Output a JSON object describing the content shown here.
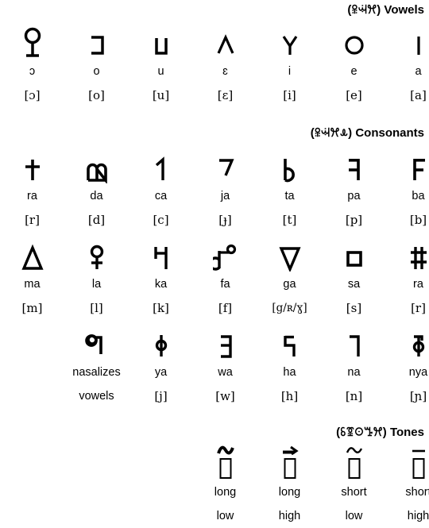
{
  "sections": {
    "vowels": {
      "native": "ꕉꕜꕮ",
      "label": "Vowels",
      "open_paren": "(",
      "close_paren": ")"
    },
    "consonants": {
      "native": "ꕉꕜꕮꕊ",
      "label": "Consonants",
      "open_paren": "(",
      "close_paren": ")"
    },
    "tones": {
      "native": "ꗏꗒꖴꔤꕮ",
      "label": "Tones",
      "open_paren": "(",
      "close_paren": ")"
    }
  },
  "vowels": [
    {
      "glyph": "ɷ",
      "icon": "vowel-glyph-o-open",
      "rom": "ɔ",
      "ipa": "[ɔ]"
    },
    {
      "glyph": "ꓱ",
      "icon": "vowel-glyph-o",
      "rom": "o",
      "ipa": "[o]"
    },
    {
      "glyph": "ᴜ",
      "icon": "vowel-glyph-u",
      "rom": "u",
      "ipa": "[u]"
    },
    {
      "glyph": "ʌ",
      "icon": "vowel-glyph-e-open",
      "rom": "ɛ",
      "ipa": "[ɛ]"
    },
    {
      "glyph": "Y",
      "icon": "vowel-glyph-i",
      "rom": "i",
      "ipa": "[i]"
    },
    {
      "glyph": "O",
      "icon": "vowel-glyph-e",
      "rom": "e",
      "ipa": "[e]"
    },
    {
      "glyph": "I",
      "icon": "vowel-glyph-a",
      "rom": "a",
      "ipa": "[a]"
    }
  ],
  "consonant_rows": [
    {
      "offset": 0,
      "items": [
        {
          "glyph": "†",
          "icon": "consonant-glyph-ra-1",
          "rom": "ra",
          "ipa": "[r]"
        },
        {
          "glyph": "ɷ",
          "icon": "consonant-glyph-da",
          "rom": "da",
          "ipa": "[d]"
        },
        {
          "glyph": "ꓸ",
          "icon": "consonant-glyph-ca",
          "rom": "ca",
          "ipa": "[c]"
        },
        {
          "glyph": "ˠ",
          "icon": "consonant-glyph-ja",
          "rom": "ja",
          "ipa": "[ɟ]"
        },
        {
          "glyph": "b",
          "icon": "consonant-glyph-ta",
          "rom": "ta",
          "ipa": "[t]"
        },
        {
          "glyph": "ꓞ",
          "icon": "consonant-glyph-pa",
          "rom": "pa",
          "ipa": "[p]"
        },
        {
          "glyph": "F",
          "icon": "consonant-glyph-ba",
          "rom": "ba",
          "ipa": "[b]"
        }
      ]
    },
    {
      "offset": 0,
      "items": [
        {
          "glyph": "Δ",
          "icon": "consonant-glyph-ma",
          "rom": "ma",
          "ipa": "[m]"
        },
        {
          "glyph": "ꝗ",
          "icon": "consonant-glyph-la",
          "rom": "la",
          "ipa": "[l]"
        },
        {
          "glyph": "ꖾ",
          "icon": "consonant-glyph-ka",
          "rom": "ka",
          "ipa": "[k]"
        },
        {
          "glyph": "ꝍ",
          "icon": "consonant-glyph-fa",
          "rom": "fa",
          "ipa": "[f]"
        },
        {
          "glyph": "∇",
          "icon": "consonant-glyph-ga",
          "rom": "ga",
          "ipa": "[g/ʀ/ɣ]"
        },
        {
          "glyph": "□",
          "icon": "consonant-glyph-sa",
          "rom": "sa",
          "ipa": "[s]"
        },
        {
          "glyph": "ǂ",
          "icon": "consonant-glyph-ra-2",
          "rom": "ra",
          "ipa": "[r]"
        }
      ]
    },
    {
      "offset": 1,
      "items": [
        {
          "glyph": "ꞁ",
          "icon": "consonant-glyph-nasalizer",
          "rom": "nasalizes",
          "ipa": "vowels"
        },
        {
          "glyph": "ɸ",
          "icon": "consonant-glyph-ya",
          "rom": "ya",
          "ipa": "[j]"
        },
        {
          "glyph": "ꓷ",
          "icon": "consonant-glyph-wa",
          "rom": "wa",
          "ipa": "[w]"
        },
        {
          "glyph": "ꓶ",
          "icon": "consonant-glyph-ha",
          "rom": "ha",
          "ipa": "[h]"
        },
        {
          "glyph": "ꓩ",
          "icon": "consonant-glyph-na",
          "rom": "na",
          "ipa": "[n]"
        },
        {
          "glyph": "ȸ",
          "icon": "consonant-glyph-nya",
          "rom": "nya",
          "ipa": "[ɲ]"
        }
      ]
    }
  ],
  "tones": {
    "offset": 3,
    "items": [
      {
        "mark": "˜",
        "icon": "tone-mark-long-low",
        "line1": "long",
        "line2": "low",
        "mark_style": "thick-tilde"
      },
      {
        "mark": "➚",
        "icon": "tone-mark-long-high",
        "line1": "long",
        "line2": "high",
        "mark_style": "arrow"
      },
      {
        "mark": "˜",
        "icon": "tone-mark-short-low",
        "line1": "short",
        "line2": "low",
        "mark_style": "thin-tilde"
      },
      {
        "mark": "ˉ",
        "icon": "tone-mark-short-high",
        "line1": "short",
        "line2": "high",
        "mark_style": "macron"
      }
    ]
  }
}
